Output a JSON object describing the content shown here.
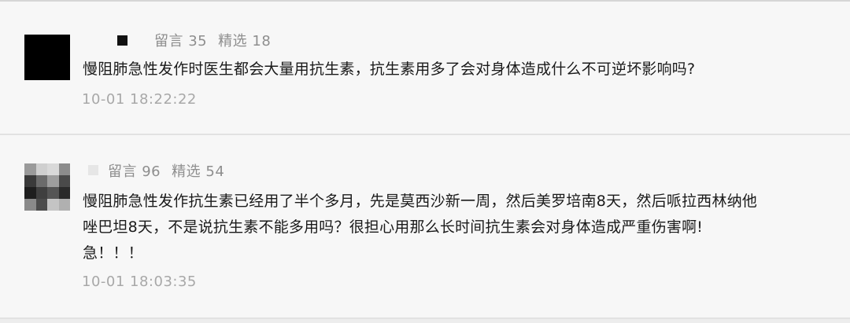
{
  "comments": [
    {
      "stats": {
        "replies_label": "留言 35",
        "picks_label": "精选 18"
      },
      "content_lines": [
        "慢阻肺急性发作时医生都会大量用抗生素，抗生素用多了会对身体造成什么不可逆坏影响吗?"
      ],
      "time": "10-01 18:22:22"
    },
    {
      "stats": {
        "replies_label": "留言 96",
        "picks_label": "精选 54"
      },
      "content_lines": [
        "慢阻肺急性发作抗生素已经用了半个多月，先是莫西沙新一周，然后美罗培南8天，然后哌拉西林纳他",
        "唑巴坦8天，不是说抗生素不能多用吗？很担心用那么长时间抗生素会对身体造成严重伤害啊!",
        "急！！！"
      ],
      "time": "10-01 18:03:35"
    }
  ],
  "colors": {
    "background": "#ededed",
    "card": "#f7f7f7",
    "meta_text": "#8e8e8e",
    "body_text": "#1a1a1a",
    "time_text": "#a8a8a8"
  }
}
